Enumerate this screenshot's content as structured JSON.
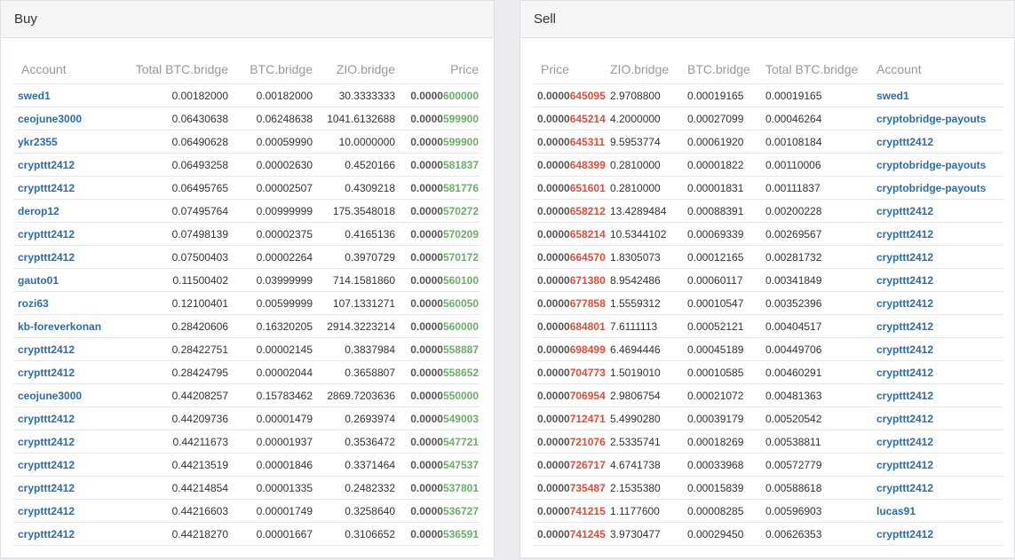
{
  "buy": {
    "title": "Buy",
    "columns": [
      "Account",
      "Total BTC.bridge",
      "BTC.bridge",
      "ZIO.bridge",
      "Price"
    ],
    "rows": [
      {
        "account": "swed1",
        "total": "0.00182000",
        "btc": "0.00182000",
        "zio": "30.3333333",
        "price_prefix": "0.0000",
        "price_suffix": "600000"
      },
      {
        "account": "ceojune3000",
        "total": "0.06430638",
        "btc": "0.06248638",
        "zio": "1041.6132688",
        "price_prefix": "0.0000",
        "price_suffix": "599900"
      },
      {
        "account": "ykr2355",
        "total": "0.06490628",
        "btc": "0.00059990",
        "zio": "10.0000000",
        "price_prefix": "0.0000",
        "price_suffix": "599900"
      },
      {
        "account": "crypttt2412",
        "total": "0.06493258",
        "btc": "0.00002630",
        "zio": "0.4520166",
        "price_prefix": "0.0000",
        "price_suffix": "581837"
      },
      {
        "account": "crypttt2412",
        "total": "0.06495765",
        "btc": "0.00002507",
        "zio": "0.4309218",
        "price_prefix": "0.0000",
        "price_suffix": "581776"
      },
      {
        "account": "derop12",
        "total": "0.07495764",
        "btc": "0.00999999",
        "zio": "175.3548018",
        "price_prefix": "0.0000",
        "price_suffix": "570272"
      },
      {
        "account": "crypttt2412",
        "total": "0.07498139",
        "btc": "0.00002375",
        "zio": "0.4165136",
        "price_prefix": "0.0000",
        "price_suffix": "570209"
      },
      {
        "account": "crypttt2412",
        "total": "0.07500403",
        "btc": "0.00002264",
        "zio": "0.3970729",
        "price_prefix": "0.0000",
        "price_suffix": "570172"
      },
      {
        "account": "gauto01",
        "total": "0.11500402",
        "btc": "0.03999999",
        "zio": "714.1581860",
        "price_prefix": "0.0000",
        "price_suffix": "560100"
      },
      {
        "account": "rozi63",
        "total": "0.12100401",
        "btc": "0.00599999",
        "zio": "107.1331271",
        "price_prefix": "0.0000",
        "price_suffix": "560050"
      },
      {
        "account": "kb-foreverkonan",
        "total": "0.28420606",
        "btc": "0.16320205",
        "zio": "2914.3223214",
        "price_prefix": "0.0000",
        "price_suffix": "560000"
      },
      {
        "account": "crypttt2412",
        "total": "0.28422751",
        "btc": "0.00002145",
        "zio": "0.3837984",
        "price_prefix": "0.0000",
        "price_suffix": "558887"
      },
      {
        "account": "crypttt2412",
        "total": "0.28424795",
        "btc": "0.00002044",
        "zio": "0.3658807",
        "price_prefix": "0.0000",
        "price_suffix": "558652"
      },
      {
        "account": "ceojune3000",
        "total": "0.44208257",
        "btc": "0.15783462",
        "zio": "2869.7203636",
        "price_prefix": "0.0000",
        "price_suffix": "550000"
      },
      {
        "account": "crypttt2412",
        "total": "0.44209736",
        "btc": "0.00001479",
        "zio": "0.2693974",
        "price_prefix": "0.0000",
        "price_suffix": "549003"
      },
      {
        "account": "crypttt2412",
        "total": "0.44211673",
        "btc": "0.00001937",
        "zio": "0.3536472",
        "price_prefix": "0.0000",
        "price_suffix": "547721"
      },
      {
        "account": "crypttt2412",
        "total": "0.44213519",
        "btc": "0.00001846",
        "zio": "0.3371464",
        "price_prefix": "0.0000",
        "price_suffix": "547537"
      },
      {
        "account": "crypttt2412",
        "total": "0.44214854",
        "btc": "0.00001335",
        "zio": "0.2482332",
        "price_prefix": "0.0000",
        "price_suffix": "537801"
      },
      {
        "account": "crypttt2412",
        "total": "0.44216603",
        "btc": "0.00001749",
        "zio": "0.3258640",
        "price_prefix": "0.0000",
        "price_suffix": "536727"
      },
      {
        "account": "crypttt2412",
        "total": "0.44218270",
        "btc": "0.00001667",
        "zio": "0.3106652",
        "price_prefix": "0.0000",
        "price_suffix": "536591"
      }
    ]
  },
  "sell": {
    "title": "Sell",
    "columns": [
      "Price",
      "ZIO.bridge",
      "BTC.bridge",
      "Total BTC.bridge",
      "Account"
    ],
    "rows": [
      {
        "price_prefix": "0.0000",
        "price_suffix": "645095",
        "zio": "2.9708800",
        "btc": "0.00019165",
        "total": "0.00019165",
        "account": "swed1"
      },
      {
        "price_prefix": "0.0000",
        "price_suffix": "645214",
        "zio": "4.2000000",
        "btc": "0.00027099",
        "total": "0.00046264",
        "account": "cryptobridge-payouts"
      },
      {
        "price_prefix": "0.0000",
        "price_suffix": "645311",
        "zio": "9.5953774",
        "btc": "0.00061920",
        "total": "0.00108184",
        "account": "crypttt2412"
      },
      {
        "price_prefix": "0.0000",
        "price_suffix": "648399",
        "zio": "0.2810000",
        "btc": "0.00001822",
        "total": "0.00110006",
        "account": "cryptobridge-payouts"
      },
      {
        "price_prefix": "0.0000",
        "price_suffix": "651601",
        "zio": "0.2810000",
        "btc": "0.00001831",
        "total": "0.00111837",
        "account": "cryptobridge-payouts"
      },
      {
        "price_prefix": "0.0000",
        "price_suffix": "658212",
        "zio": "13.4289484",
        "btc": "0.00088391",
        "total": "0.00200228",
        "account": "crypttt2412"
      },
      {
        "price_prefix": "0.0000",
        "price_suffix": "658214",
        "zio": "10.5344102",
        "btc": "0.00069339",
        "total": "0.00269567",
        "account": "crypttt2412"
      },
      {
        "price_prefix": "0.0000",
        "price_suffix": "664570",
        "zio": "1.8305073",
        "btc": "0.00012165",
        "total": "0.00281732",
        "account": "crypttt2412"
      },
      {
        "price_prefix": "0.0000",
        "price_suffix": "671380",
        "zio": "8.9542486",
        "btc": "0.00060117",
        "total": "0.00341849",
        "account": "crypttt2412"
      },
      {
        "price_prefix": "0.0000",
        "price_suffix": "677858",
        "zio": "1.5559312",
        "btc": "0.00010547",
        "total": "0.00352396",
        "account": "crypttt2412"
      },
      {
        "price_prefix": "0.0000",
        "price_suffix": "684801",
        "zio": "7.6111113",
        "btc": "0.00052121",
        "total": "0.00404517",
        "account": "crypttt2412"
      },
      {
        "price_prefix": "0.0000",
        "price_suffix": "698499",
        "zio": "6.4694446",
        "btc": "0.00045189",
        "total": "0.00449706",
        "account": "crypttt2412"
      },
      {
        "price_prefix": "0.0000",
        "price_suffix": "704773",
        "zio": "1.5019010",
        "btc": "0.00010585",
        "total": "0.00460291",
        "account": "crypttt2412"
      },
      {
        "price_prefix": "0.0000",
        "price_suffix": "706954",
        "zio": "2.9806754",
        "btc": "0.00021072",
        "total": "0.00481363",
        "account": "crypttt2412"
      },
      {
        "price_prefix": "0.0000",
        "price_suffix": "712471",
        "zio": "5.4990280",
        "btc": "0.00039179",
        "total": "0.00520542",
        "account": "crypttt2412"
      },
      {
        "price_prefix": "0.0000",
        "price_suffix": "721076",
        "zio": "2.5335741",
        "btc": "0.00018269",
        "total": "0.00538811",
        "account": "crypttt2412"
      },
      {
        "price_prefix": "0.0000",
        "price_suffix": "726717",
        "zio": "4.6741738",
        "btc": "0.00033968",
        "total": "0.00572779",
        "account": "crypttt2412"
      },
      {
        "price_prefix": "0.0000",
        "price_suffix": "735487",
        "zio": "2.1535380",
        "btc": "0.00015839",
        "total": "0.00588618",
        "account": "crypttt2412"
      },
      {
        "price_prefix": "0.0000",
        "price_suffix": "741215",
        "zio": "1.1177600",
        "btc": "0.00008285",
        "total": "0.00596903",
        "account": "lucas91"
      },
      {
        "price_prefix": "0.0000",
        "price_suffix": "741245",
        "zio": "3.9730477",
        "btc": "0.00029450",
        "total": "0.00626353",
        "account": "crypttt2412"
      }
    ]
  },
  "colors": {
    "buy_price_accent": "#6cad6c",
    "sell_price_accent": "#e04e3a",
    "account_link": "#2e6da4"
  }
}
